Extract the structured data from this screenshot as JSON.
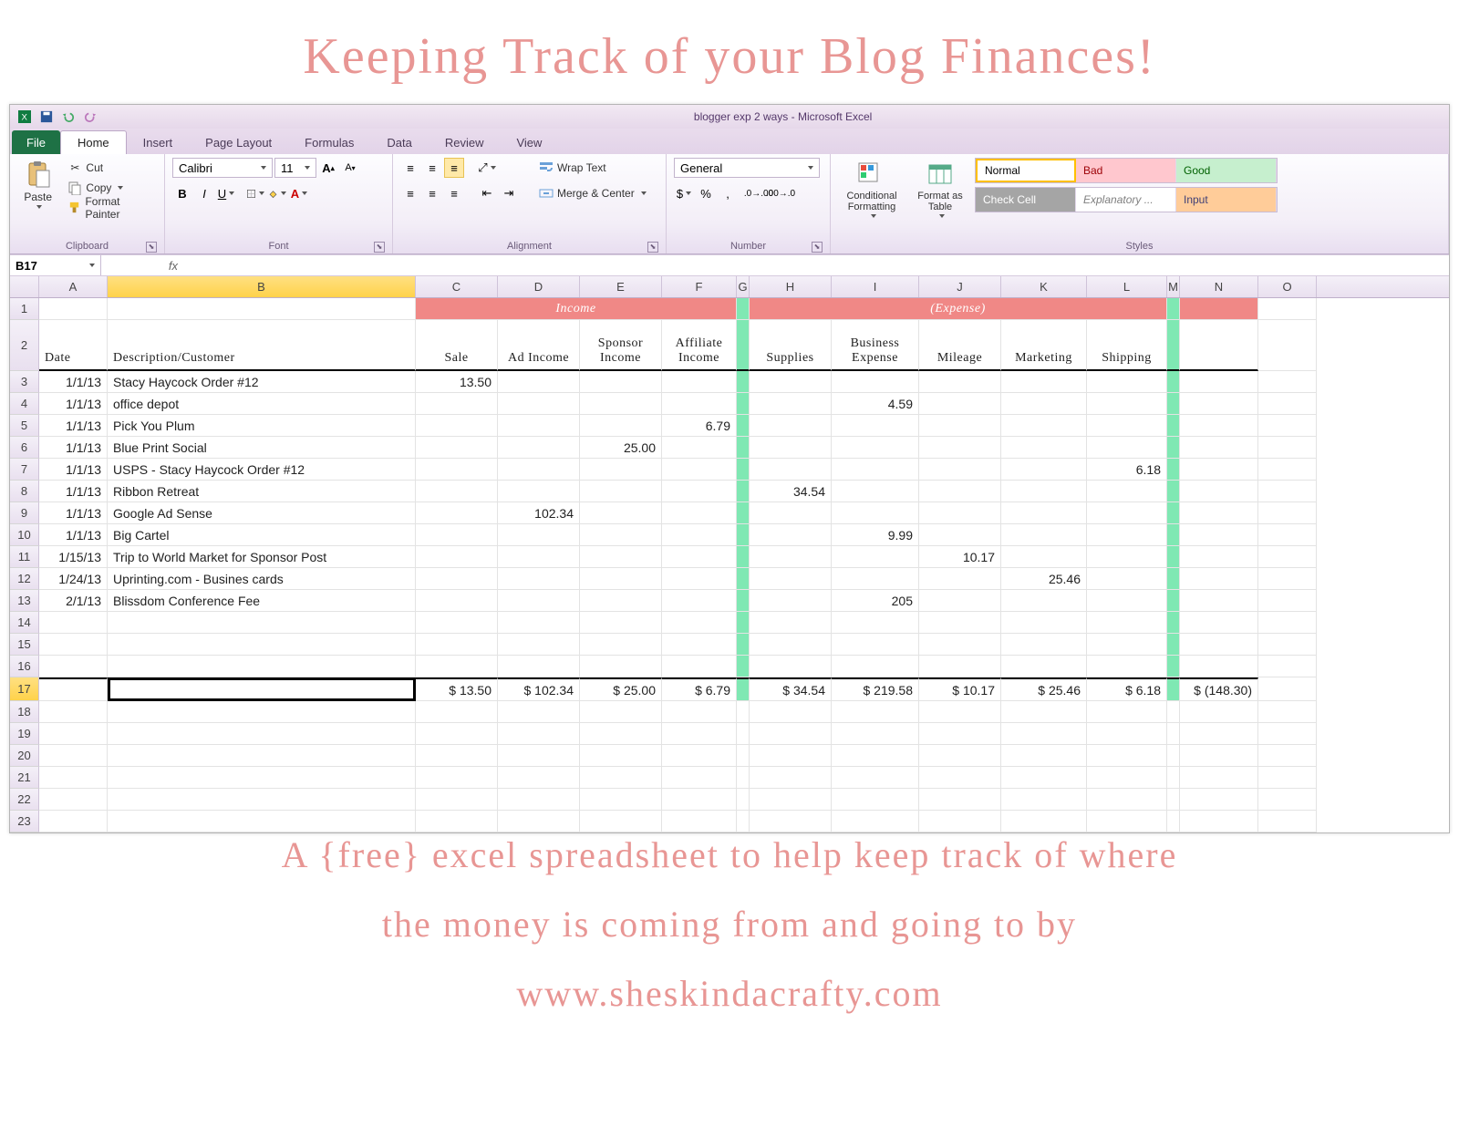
{
  "page": {
    "title_overlay": "Keeping Track of your Blog Finances!",
    "footer1": "A {free} excel spreadsheet to help keep track of where",
    "footer2": "the money is coming from and going to by",
    "footer3": "www.sheskindacrafty.com"
  },
  "window": {
    "doc_title": "blogger exp 2 ways - Microsoft Excel"
  },
  "tabs": {
    "file": "File",
    "home": "Home",
    "insert": "Insert",
    "page_layout": "Page Layout",
    "formulas": "Formulas",
    "data": "Data",
    "review": "Review",
    "view": "View"
  },
  "ribbon": {
    "paste": "Paste",
    "cut": "Cut",
    "copy": "Copy",
    "format_painter": "Format Painter",
    "clipboard_group": "Clipboard",
    "font_name": "Calibri",
    "font_size": "11",
    "font_group": "Font",
    "wrap_text": "Wrap Text",
    "merge_center": "Merge & Center",
    "alignment_group": "Alignment",
    "number_format": "General",
    "number_group": "Number",
    "cond_fmt": "Conditional Formatting",
    "fmt_table": "Format as Table",
    "style_normal": "Normal",
    "style_bad": "Bad",
    "style_good": "Good",
    "style_check": "Check Cell",
    "style_exp": "Explanatory ...",
    "style_input": "Input",
    "styles_group": "Styles"
  },
  "namebox": "B17",
  "columns": [
    "A",
    "B",
    "C",
    "D",
    "E",
    "F",
    "G",
    "H",
    "I",
    "J",
    "K",
    "L",
    "M",
    "N",
    "O"
  ],
  "merged_headers": {
    "income": "Income",
    "expense": "(Expense)"
  },
  "col_headers_row2": {
    "date": "Date",
    "desc": "Description/Customer",
    "sale": "Sale",
    "ad": "Ad Income",
    "sponsor": "Sponsor Income",
    "affiliate": "Affiliate Income",
    "supplies": "Supplies",
    "biz": "Business Expense",
    "mileage": "Mileage",
    "marketing": "Marketing",
    "shipping": "Shipping"
  },
  "rows": [
    {
      "r": 3,
      "date": "1/1/13",
      "desc": "Stacy Haycock Order #12",
      "C": "13.50"
    },
    {
      "r": 4,
      "date": "1/1/13",
      "desc": "office depot",
      "I": "4.59"
    },
    {
      "r": 5,
      "date": "1/1/13",
      "desc": "Pick You Plum",
      "F": "6.79"
    },
    {
      "r": 6,
      "date": "1/1/13",
      "desc": "Blue Print Social",
      "E": "25.00"
    },
    {
      "r": 7,
      "date": "1/1/13",
      "desc": "USPS - Stacy Haycock Order #12",
      "L": "6.18"
    },
    {
      "r": 8,
      "date": "1/1/13",
      "desc": "Ribbon Retreat",
      "H": "34.54"
    },
    {
      "r": 9,
      "date": "1/1/13",
      "desc": "Google Ad Sense",
      "D": "102.34"
    },
    {
      "r": 10,
      "date": "1/1/13",
      "desc": "Big Cartel",
      "I": "9.99"
    },
    {
      "r": 11,
      "date": "1/15/13",
      "desc": "Trip to World Market for Sponsor Post",
      "J": "10.17"
    },
    {
      "r": 12,
      "date": "1/24/13",
      "desc": "Uprinting.com - Busines cards",
      "K": "25.46"
    },
    {
      "r": 13,
      "date": "2/1/13",
      "desc": "Blissdom Conference Fee",
      "I": "205"
    }
  ],
  "totals": {
    "C": "$    13.50",
    "D": "$   102.34",
    "E": "$    25.00",
    "F": "$     6.79",
    "H": "$    34.54",
    "I": "$   219.58",
    "J": "$    10.17",
    "K": "$    25.46",
    "L": "$     6.18",
    "N": "$  (148.30)"
  }
}
